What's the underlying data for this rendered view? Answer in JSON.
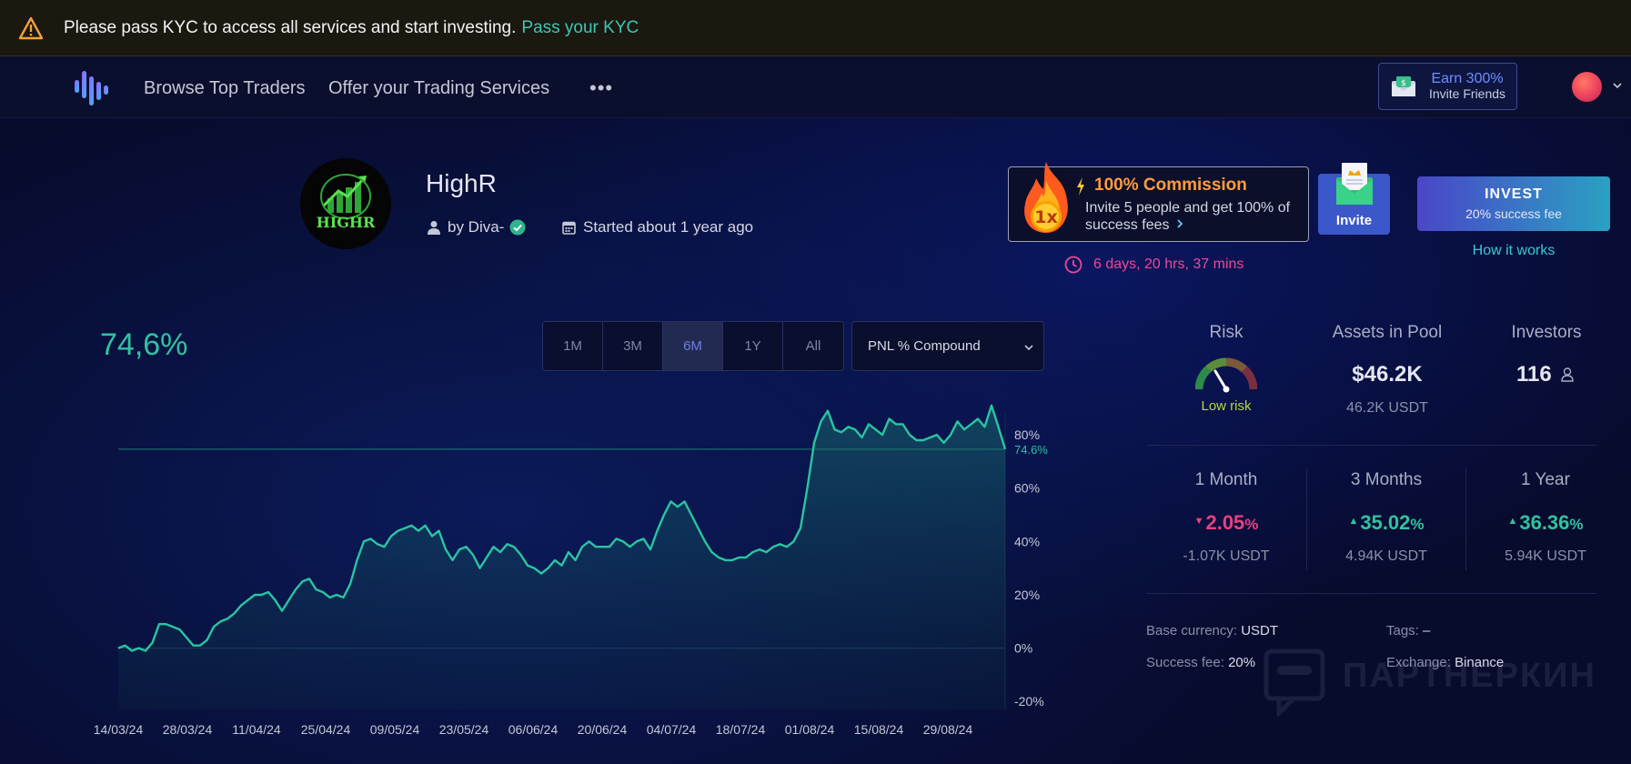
{
  "kyc_banner": {
    "text": "Please pass KYC to access all services and start investing.",
    "link": "Pass your KYC"
  },
  "nav": {
    "items": [
      "Browse Top Traders",
      "Offer your Trading Services"
    ],
    "more": "•••",
    "earn": {
      "title": "Earn 300%",
      "subtitle": "Invite Friends"
    }
  },
  "trader": {
    "name": "HighR",
    "logo_text": "HIGHR",
    "author": "by Diva-",
    "started": "Started about 1 year ago"
  },
  "promo": {
    "badge": "1x",
    "title": "100% Commission",
    "description": "Invite 5 people and get 100% of success fees",
    "invite_label": "Invite",
    "timer": "6 days, 20 hrs, 37 mins"
  },
  "invest": {
    "label": "INVEST",
    "fee": "20% success fee",
    "how": "How it works"
  },
  "chart_controls": {
    "headline": "74,6%",
    "periods": [
      "1M",
      "3M",
      "6M",
      "1Y",
      "All"
    ],
    "active_period": "6M",
    "metric": "PNL % Compound"
  },
  "chart_data": {
    "type": "area",
    "x": [
      "14/03/24",
      "28/03/24",
      "11/04/24",
      "25/04/24",
      "09/05/24",
      "23/05/24",
      "06/06/24",
      "20/06/24",
      "04/07/24",
      "18/07/24",
      "01/08/24",
      "15/08/24",
      "29/08/24"
    ],
    "xlabels": [
      "14/03/24",
      "28/03/24",
      "11/04/24",
      "25/04/24",
      "09/05/24",
      "23/05/24",
      "06/06/24",
      "20/06/24",
      "04/07/24",
      "18/07/24",
      "01/08/24",
      "15/08/24",
      "29/08/24"
    ],
    "y_ticks": [
      "80%",
      "60%",
      "40%",
      "20%",
      "0%",
      "-20%"
    ],
    "ylim": [
      -23,
      93
    ],
    "current_value": 74.6,
    "current_label": "74.6%",
    "series": [
      {
        "values": [
          0,
          1,
          -1,
          0,
          -1,
          2,
          9,
          9,
          8,
          7,
          4,
          1,
          1,
          3,
          8,
          10,
          11,
          13,
          16,
          18,
          20,
          20,
          21,
          18,
          14,
          18,
          22,
          25,
          26,
          22,
          21,
          19,
          20,
          19,
          24,
          33,
          40,
          41,
          39,
          38,
          42,
          44,
          45,
          46,
          44,
          46,
          42,
          44,
          37,
          33,
          37,
          38,
          35,
          30,
          34,
          38,
          36,
          39,
          38,
          35,
          31,
          30,
          28,
          30,
          33,
          31,
          36,
          33,
          38,
          40,
          38,
          38,
          38,
          41,
          40,
          38,
          40,
          41,
          37,
          44,
          50,
          55,
          53,
          55,
          50,
          45,
          40,
          36,
          34,
          33,
          33,
          34,
          34,
          36,
          37,
          36,
          38,
          39,
          38,
          40,
          45,
          60,
          77,
          85,
          89,
          82,
          81,
          83,
          82,
          79,
          84,
          82,
          80,
          86,
          84,
          84,
          80,
          78,
          78,
          79,
          80,
          77,
          80,
          85,
          82,
          84,
          86,
          83,
          91,
          83,
          74.6
        ]
      }
    ]
  },
  "stats": {
    "risk": {
      "label": "Risk",
      "value": "Low risk"
    },
    "pool": {
      "label": "Assets in Pool",
      "value": "$46.2K",
      "sub": "46.2K USDT"
    },
    "investors": {
      "label": "Investors",
      "value": "116"
    },
    "returns": [
      {
        "label": "1 Month",
        "dir": "down",
        "value": "2.05",
        "sub": "-1.07K USDT"
      },
      {
        "label": "3 Months",
        "dir": "up",
        "value": "35.02",
        "sub": "4.94K USDT"
      },
      {
        "label": "1 Year",
        "dir": "up",
        "value": "36.36",
        "sub": "5.94K USDT"
      }
    ],
    "percent_sign": "%",
    "arrow_down": "▼",
    "arrow_up": "▲",
    "info": {
      "base_currency_label": "Base currency:",
      "base_currency": "USDT",
      "tags_label": "Tags:",
      "tags": "–",
      "fee_label": "Success fee:",
      "fee": "20%",
      "exchange_label": "Exchange:",
      "exchange": "Binance"
    }
  },
  "watermark": "ПАРТНЕРКИН",
  "colors": {
    "accent": "#31c2a1",
    "negative": "#e8407f",
    "brand": "#4a46c8",
    "warning": "#ff9b3d"
  }
}
